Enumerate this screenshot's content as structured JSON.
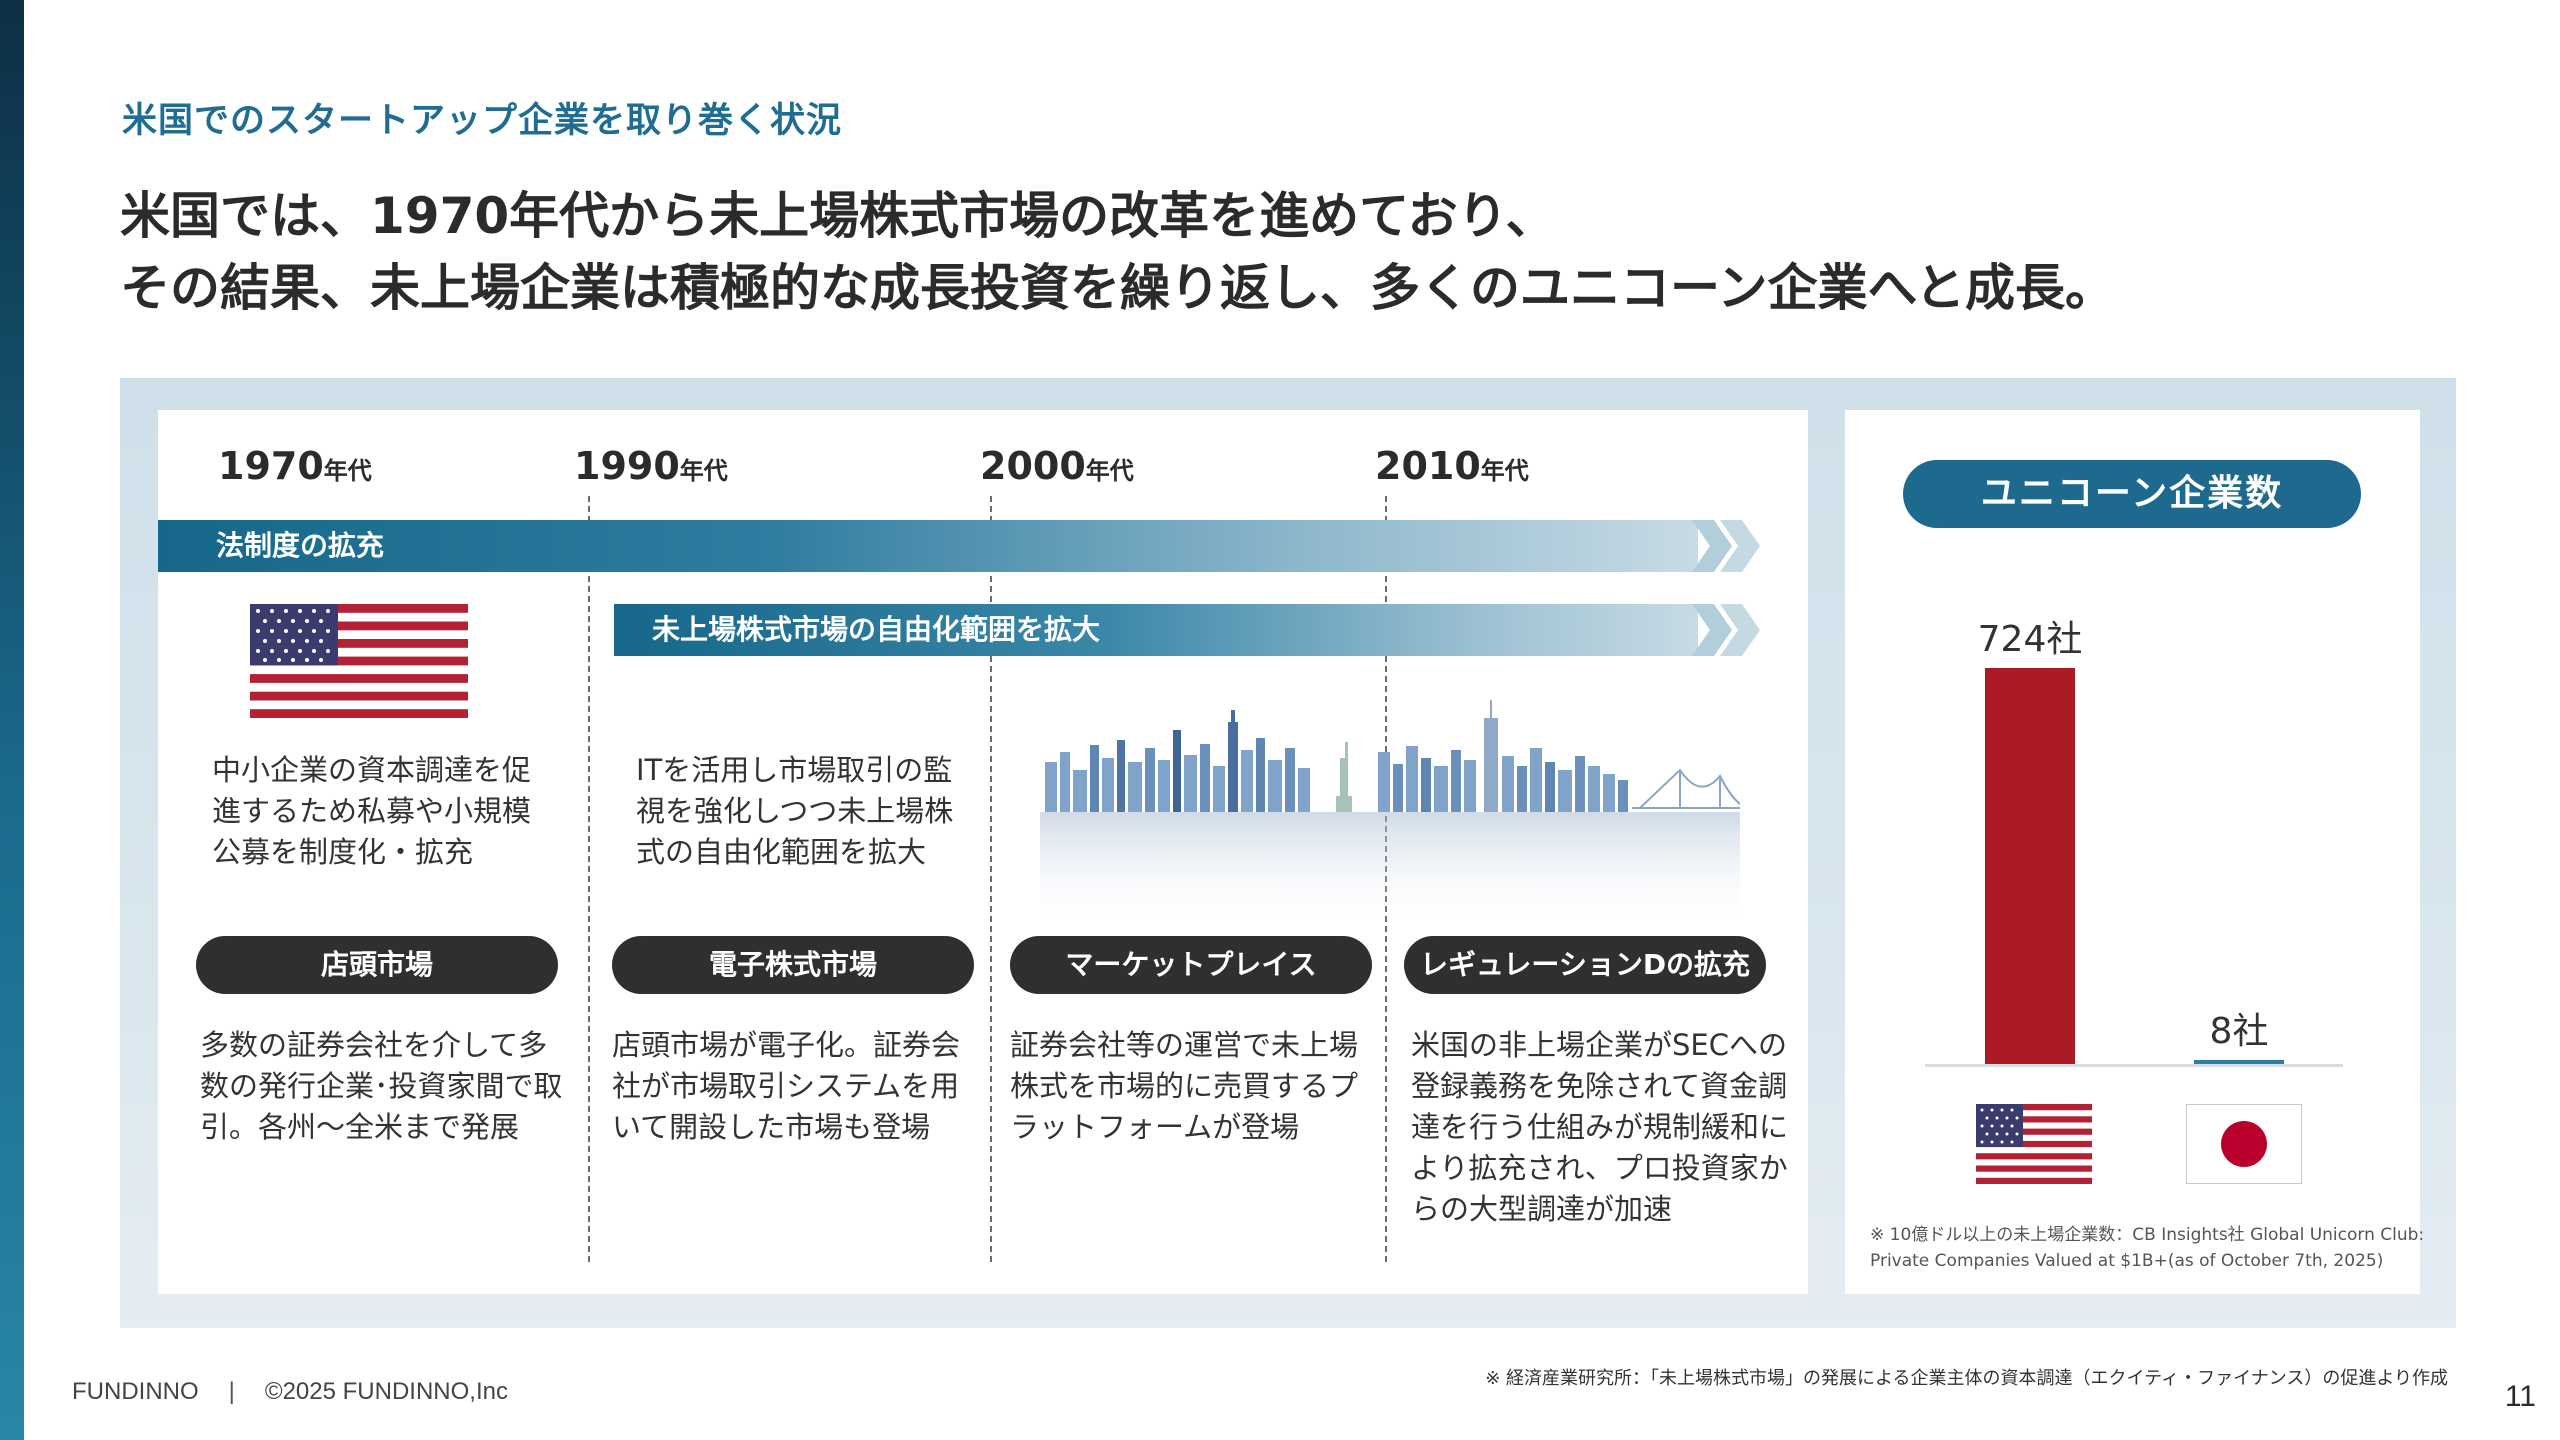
{
  "subtitle": "米国でのスタートアップ企業を取り巻く状況",
  "headline": {
    "line1": "米国では、1970年代から未上場株式市場の改革を進めており、",
    "line2": "その結果、未上場企業は積極的な成長投資を繰り返し、多くのユニコーン企業へと成長。"
  },
  "timeline": {
    "decades": [
      {
        "year": "1970",
        "suffix": "年代"
      },
      {
        "year": "1990",
        "suffix": "年代"
      },
      {
        "year": "2000",
        "suffix": "年代"
      },
      {
        "year": "2010",
        "suffix": "年代"
      }
    ],
    "band1": "法制度の拡充",
    "band2": "未上場株式市場の自由化範囲を拡大",
    "notes": [
      "中小企業の資本調達を促\n進するため私募や小規模\n公募を制度化・拡充",
      "ITを活用し市場取引の監\n視を強化しつつ未上場株\n式の自由化範囲を拡大"
    ],
    "markets": [
      {
        "label": "店頭市場",
        "desc": "多数の証券会社を介して多\n数の発行企業･投資家間で取\n引。各州〜全米まで発展"
      },
      {
        "label": "電子株式市場",
        "desc": "店頭市場が電子化。証券会\n社が市場取引システムを用\nいて開設した市場も登場"
      },
      {
        "label": "マーケットプレイス",
        "desc": "証券会社等の運営で未上場\n株式を市場的に売買するプ\nラットフォームが登場"
      },
      {
        "label": "レギュレーションDの拡充",
        "desc": "米国の非上場企業がSECへの\n登録義務を免除されて資金調\n達を行う仕組みが規制緩和に\nより拡充され、プロ投資家か\nらの大型調達が加速"
      }
    ]
  },
  "unicorn": {
    "title": "ユニコーン企業数",
    "note": "※ 10億ドル以上の未上場企業数：CB Insights社 Global Unicorn Club:\nPrivate Companies Valued at $1B+(as of October 7th, 2025)"
  },
  "chart_data": {
    "type": "bar",
    "categories": [
      "US",
      "Japan"
    ],
    "values": [
      724,
      8
    ],
    "labels": [
      "724社",
      "8社"
    ],
    "title": "ユニコーン企業数",
    "colors": [
      "#ab1a25",
      "#2e7ea3"
    ]
  },
  "colors": {
    "accent": "#1f6d92",
    "pill_dark": "#2f2f2f",
    "us_red": "#b22234",
    "us_blue": "#3c3b6e",
    "jp_red": "#bc002d"
  },
  "footer": {
    "brand": "FUNDINNO",
    "copyright": "©2025 FUNDINNO,Inc",
    "source": "※ 経済産業研究所：「未上場株式市場」の発展による企業主体の資本調達（エクイティ・ファイナンス）の促進より作成",
    "page": "11"
  }
}
